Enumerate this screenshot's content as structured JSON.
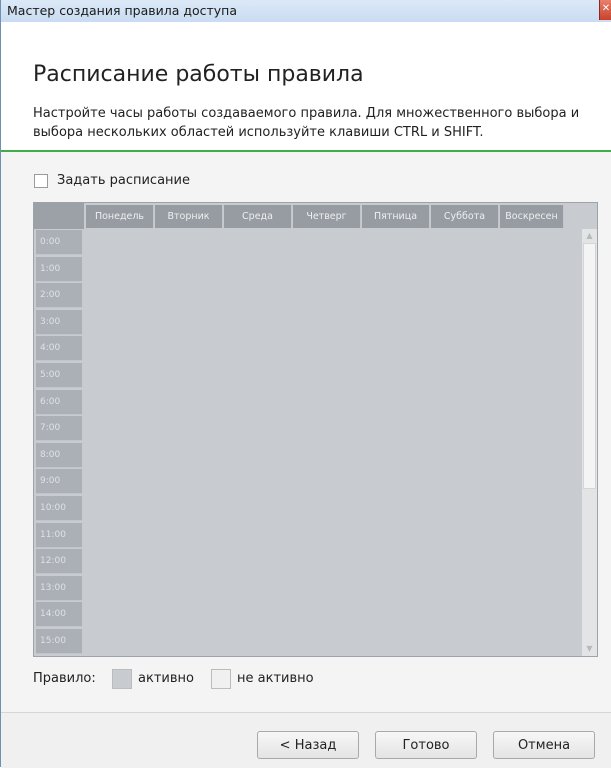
{
  "window": {
    "title": "Мастер создания правила доступа"
  },
  "header": {
    "heading": "Расписание работы правила",
    "subtitle": "Настройте часы работы создаваемого правила. Для множественного выбора и выбора нескольких областей используйте клавиши CTRL и SHIFT."
  },
  "schedule_toggle": {
    "label": "Задать расписание",
    "checked": false
  },
  "grid": {
    "days": [
      "Понедель",
      "Вторник",
      "Среда",
      "Четверг",
      "Пятница",
      "Суббота",
      "Воскресен"
    ],
    "hours": [
      "0:00",
      "1:00",
      "2:00",
      "3:00",
      "4:00",
      "5:00",
      "6:00",
      "7:00",
      "8:00",
      "9:00",
      "10:00",
      "11:00",
      "12:00",
      "13:00",
      "14:00",
      "15:00"
    ]
  },
  "legend": {
    "label": "Правило:",
    "active": "активно",
    "inactive": "не активно",
    "active_color": "#c8ccd0",
    "inactive_color": "#f0f0f0"
  },
  "buttons": {
    "back": "< Назад",
    "finish": "Готово",
    "cancel": "Отмена"
  },
  "icons": {
    "close": "close-icon"
  }
}
